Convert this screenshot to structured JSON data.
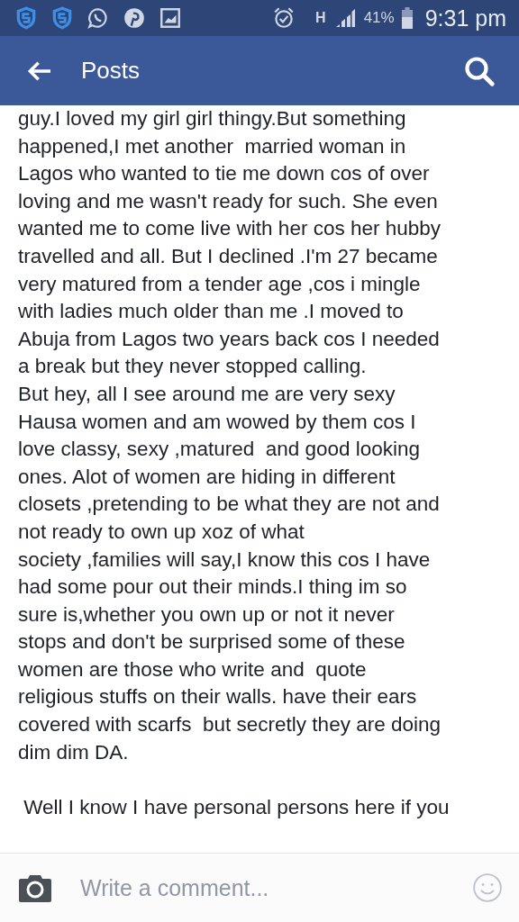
{
  "status_bar": {
    "network_type": "H",
    "battery": "41%",
    "time": "9:31 pm"
  },
  "app_bar": {
    "title": "Posts"
  },
  "post": {
    "paragraphs": [
      [
        "guy.I loved my girl girl thingy.But something",
        "happened,I met another  married woman in",
        "Lagos who wanted to tie me down cos of over",
        "loving and me wasn't ready for such. She even",
        "wanted me to come live with her cos her hubby",
        "travelled and all. But I declined .I'm 27 became",
        "very matured from a tender age ,cos i mingle",
        "with ladies much older than me .I moved to",
        "Abuja from Lagos two years back cos I needed",
        "a break but they never stopped calling.",
        "But hey, all I see around me are very sexy",
        "Hausa women and am wowed by them cos I",
        "love classy, sexy ,matured  and good looking",
        "ones. Alot of women are hiding in different",
        "closets ,pretending to be what they are not and",
        "not ready to own up xoz of what",
        "society ,families will say,I know this cos I have",
        "had some pour out their minds.I thing im so",
        "sure is,whether you own up or not it never",
        "stops and don't be surprised some of these",
        "women are those who write and  quote",
        "religious stuffs on their walls. have their ears",
        "covered with scarfs  but secretly they are doing",
        "dim dim DA."
      ],
      [
        " Well I know I have personal persons here if you"
      ]
    ]
  },
  "comment_bar": {
    "placeholder": "Write a comment..."
  }
}
